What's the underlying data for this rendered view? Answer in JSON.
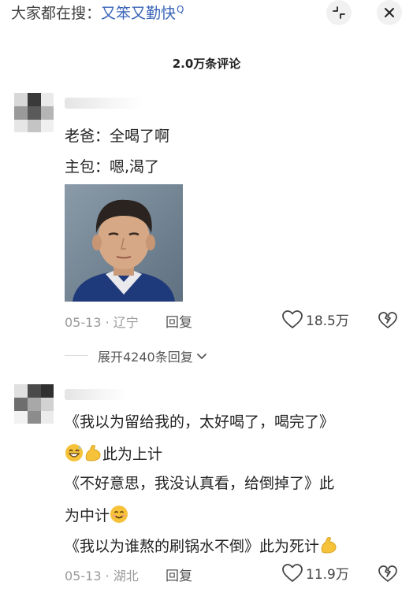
{
  "header": {
    "search_label": "大家都在搜：",
    "search_keyword": "又笨又勤快",
    "search_marker": "Q",
    "collapse_icon": "collapse-icon",
    "close_icon": "close-icon"
  },
  "comment_count": "2.0万条评论",
  "comments": [
    {
      "lines": [
        "老爸：全喝了啊",
        "主包：嗯,渴了"
      ],
      "has_image": true,
      "date": "05-13",
      "location": "辽宁",
      "reply_label": "回复",
      "likes": "18.5万",
      "expand_label": "展开4240条回复"
    },
    {
      "lines": [
        "《我以为留给我的，太好喝了，喝完了》",
        "此为上计",
        "《不好意思，我没认真看，给倒掉了》此",
        "为中计",
        "《我以为谁熬的刷锅水不倒》此为死计"
      ],
      "date": "05-13",
      "location": "湖北",
      "reply_label": "回复",
      "likes": "11.9万"
    }
  ],
  "colors": {
    "accent": "#3a64b8",
    "meta": "#9a9a9a",
    "emoji_yellow": "#f6c23a"
  }
}
